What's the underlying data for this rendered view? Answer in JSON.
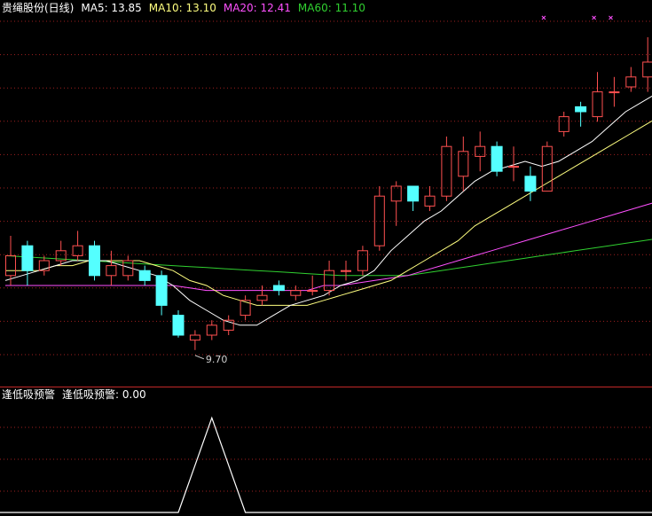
{
  "main_header": {
    "stock_name": "贵绳股份(日线)",
    "ma5": "MA5: 13.85",
    "ma10": "MA10: 13.10",
    "ma20": "MA20: 12.41",
    "ma60": "MA60: 11.10"
  },
  "indicator_header": {
    "name": "逢低吸预警",
    "value_label": "逢低吸预警: 0.00"
  },
  "colors": {
    "background": "#000000",
    "up": "#ff5050",
    "down": "#54ffff",
    "ma5": "#ffffff",
    "ma10": "#ffff80",
    "ma20": "#ff50ff",
    "ma60": "#30d030",
    "grid": "#a02020",
    "signal_mark": "#ff50ff",
    "indicator_line": "#ffffff"
  },
  "chart_data": [
    {
      "type": "candlestick",
      "price_range": [
        9.0,
        16.5
      ],
      "min_label": "9.70",
      "min_value": 9.7,
      "candles": [
        {
          "o": 11.2,
          "c": 11.6,
          "h": 12.0,
          "l": 11.0
        },
        {
          "o": 11.8,
          "c": 11.3,
          "h": 11.9,
          "l": 11.0
        },
        {
          "o": 11.3,
          "c": 11.5,
          "h": 11.6,
          "l": 11.2
        },
        {
          "o": 11.5,
          "c": 11.7,
          "h": 11.9,
          "l": 11.4
        },
        {
          "o": 11.6,
          "c": 11.8,
          "h": 12.1,
          "l": 11.5
        },
        {
          "o": 11.8,
          "c": 11.2,
          "h": 11.9,
          "l": 11.1
        },
        {
          "o": 11.2,
          "c": 11.4,
          "h": 11.7,
          "l": 11.0
        },
        {
          "o": 11.2,
          "c": 11.5,
          "h": 11.6,
          "l": 11.1
        },
        {
          "o": 11.3,
          "c": 11.1,
          "h": 11.4,
          "l": 11.0
        },
        {
          "o": 11.2,
          "c": 10.6,
          "h": 11.3,
          "l": 10.4
        },
        {
          "o": 10.4,
          "c": 10.0,
          "h": 10.5,
          "l": 9.95
        },
        {
          "o": 9.9,
          "c": 10.0,
          "h": 10.1,
          "l": 9.7
        },
        {
          "o": 10.0,
          "c": 10.2,
          "h": 10.3,
          "l": 9.9
        },
        {
          "o": 10.1,
          "c": 10.3,
          "h": 10.4,
          "l": 10.0
        },
        {
          "o": 10.4,
          "c": 10.7,
          "h": 10.8,
          "l": 10.3
        },
        {
          "o": 10.7,
          "c": 10.8,
          "h": 11.0,
          "l": 10.6
        },
        {
          "o": 11.0,
          "c": 10.9,
          "h": 11.1,
          "l": 10.8
        },
        {
          "o": 10.8,
          "c": 10.9,
          "h": 11.0,
          "l": 10.7
        },
        {
          "o": 10.9,
          "c": 10.9,
          "h": 11.2,
          "l": 10.8
        },
        {
          "o": 10.9,
          "c": 11.3,
          "h": 11.5,
          "l": 10.8
        },
        {
          "o": 11.3,
          "c": 11.3,
          "h": 11.5,
          "l": 11.1
        },
        {
          "o": 11.3,
          "c": 11.7,
          "h": 11.8,
          "l": 11.2
        },
        {
          "o": 11.8,
          "c": 12.8,
          "h": 13.0,
          "l": 11.7
        },
        {
          "o": 12.7,
          "c": 13.0,
          "h": 13.1,
          "l": 12.2
        },
        {
          "o": 13.0,
          "c": 12.7,
          "h": 13.0,
          "l": 12.5
        },
        {
          "o": 12.6,
          "c": 12.8,
          "h": 13.0,
          "l": 12.5
        },
        {
          "o": 12.8,
          "c": 13.8,
          "h": 14.0,
          "l": 12.7
        },
        {
          "o": 13.2,
          "c": 13.7,
          "h": 14.0,
          "l": 12.9
        },
        {
          "o": 13.6,
          "c": 13.8,
          "h": 14.1,
          "l": 13.3
        },
        {
          "o": 13.8,
          "c": 13.3,
          "h": 13.9,
          "l": 13.2
        },
        {
          "o": 13.4,
          "c": 13.4,
          "h": 13.8,
          "l": 13.1
        },
        {
          "o": 13.2,
          "c": 12.9,
          "h": 13.4,
          "l": 12.7
        },
        {
          "o": 12.9,
          "c": 13.8,
          "h": 13.9,
          "l": 12.9
        },
        {
          "o": 14.1,
          "c": 14.4,
          "h": 14.5,
          "l": 14.0
        },
        {
          "o": 14.6,
          "c": 14.5,
          "h": 14.7,
          "l": 14.2
        },
        {
          "o": 14.4,
          "c": 14.9,
          "h": 15.3,
          "l": 14.3
        },
        {
          "o": 14.9,
          "c": 14.9,
          "h": 15.2,
          "l": 14.6
        },
        {
          "o": 15.0,
          "c": 15.2,
          "h": 15.4,
          "l": 14.9
        },
        {
          "o": 15.2,
          "c": 15.5,
          "h": 16.0,
          "l": 14.9
        }
      ],
      "ma5": [
        11.1,
        11.2,
        11.3,
        11.4,
        11.5,
        11.5,
        11.5,
        11.4,
        11.3,
        11.2,
        11.0,
        10.7,
        10.5,
        10.3,
        10.2,
        10.2,
        10.4,
        10.6,
        10.7,
        10.8,
        11.0,
        11.1,
        11.3,
        11.7,
        12.0,
        12.3,
        12.5,
        12.8,
        13.1,
        13.3,
        13.4,
        13.5,
        13.4,
        13.5,
        13.7,
        13.9,
        14.2,
        14.5,
        14.7,
        14.9,
        15.1
      ],
      "ma10": [
        11.3,
        11.3,
        11.3,
        11.4,
        11.4,
        11.5,
        11.5,
        11.5,
        11.5,
        11.4,
        11.3,
        11.1,
        11.0,
        10.8,
        10.7,
        10.6,
        10.6,
        10.6,
        10.6,
        10.7,
        10.8,
        10.9,
        11.0,
        11.1,
        11.3,
        11.5,
        11.7,
        11.9,
        12.2,
        12.4,
        12.6,
        12.8,
        13.0,
        13.2,
        13.4,
        13.6,
        13.8,
        14.0,
        14.2,
        14.4,
        14.6
      ],
      "ma20": [
        11.0,
        11.0,
        11.0,
        11.0,
        11.0,
        11.0,
        11.0,
        11.0,
        11.0,
        11.0,
        11.0,
        10.95,
        10.9,
        10.9,
        10.9,
        10.9,
        10.9,
        10.9,
        10.9,
        11.0,
        11.0,
        11.05,
        11.1,
        11.15,
        11.2,
        11.3,
        11.4,
        11.5,
        11.6,
        11.7,
        11.8,
        11.9,
        12.0,
        12.1,
        12.2,
        12.3,
        12.4,
        12.5,
        12.6,
        12.7,
        12.8
      ],
      "ma60": [
        11.6,
        11.58,
        11.56,
        11.54,
        11.52,
        11.5,
        11.48,
        11.46,
        11.44,
        11.42,
        11.4,
        11.38,
        11.36,
        11.34,
        11.32,
        11.3,
        11.28,
        11.26,
        11.24,
        11.22,
        11.2,
        11.2,
        11.2,
        11.2,
        11.2,
        11.25,
        11.3,
        11.35,
        11.4,
        11.45,
        11.5,
        11.55,
        11.6,
        11.65,
        11.7,
        11.75,
        11.8,
        11.85,
        11.9,
        11.95,
        12.0
      ],
      "signal_marks_at": [
        31,
        34,
        35,
        38
      ]
    },
    {
      "type": "line",
      "title": "逢低吸预警",
      "x": [
        10,
        11,
        12,
        13,
        14
      ],
      "values": [
        0,
        0.5,
        1,
        0.5,
        0
      ],
      "ylim": [
        0,
        1.2
      ]
    }
  ]
}
